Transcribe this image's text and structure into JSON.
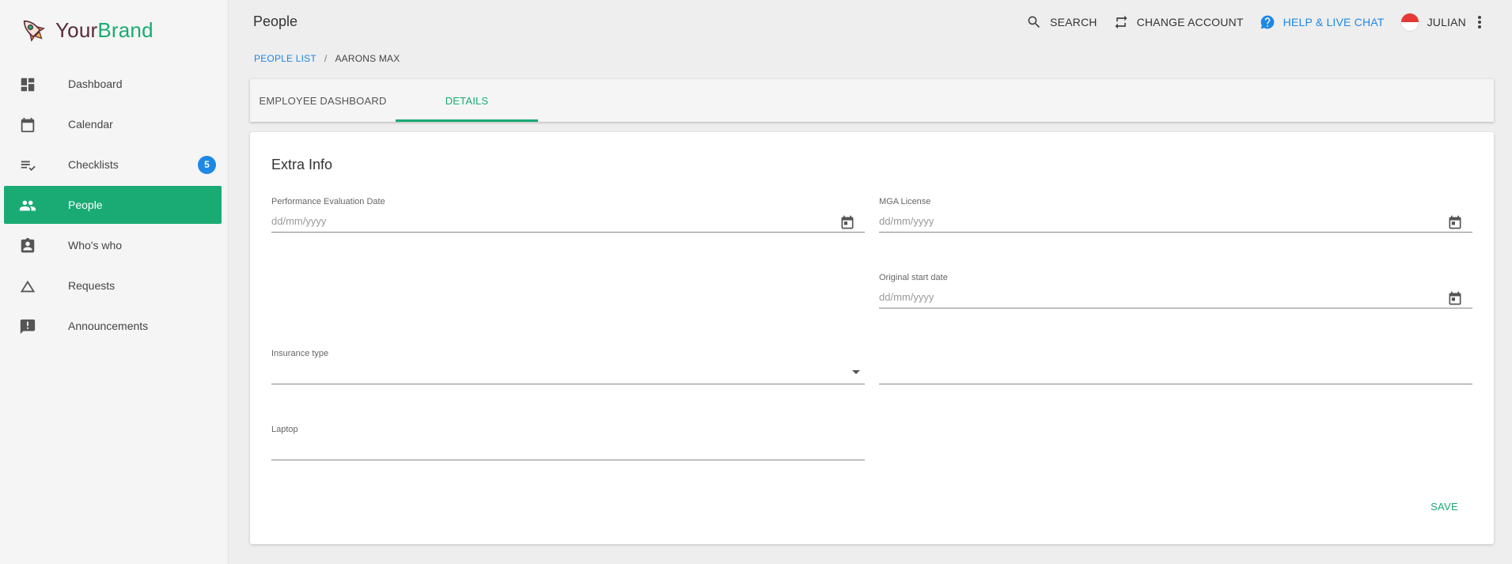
{
  "brand": {
    "part1": "Your",
    "part2": "Brand"
  },
  "sidebar": {
    "items": [
      {
        "label": "Dashboard",
        "icon": "dashboard-icon"
      },
      {
        "label": "Calendar",
        "icon": "calendar-icon"
      },
      {
        "label": "Checklists",
        "icon": "checklist-icon",
        "badge": "5"
      },
      {
        "label": "People",
        "icon": "people-icon",
        "active": true
      },
      {
        "label": "Who's who",
        "icon": "contact-card-icon"
      },
      {
        "label": "Requests",
        "icon": "triangle-icon"
      },
      {
        "label": "Announcements",
        "icon": "announcement-icon"
      }
    ]
  },
  "header": {
    "title": "People",
    "search_label": "SEARCH",
    "change_account_label": "CHANGE ACCOUNT",
    "help_label": "HELP & LIVE CHAT",
    "user_name": "JULIAN"
  },
  "breadcrumb": {
    "parent": "PEOPLE LIST",
    "separator": "/",
    "current": "AARONS MAX"
  },
  "tabs": [
    {
      "label": "EMPLOYEE DASHBOARD"
    },
    {
      "label": "DETAILS",
      "active": true
    }
  ],
  "form": {
    "title": "Extra Info",
    "performance_evaluation_date": {
      "label": "Performance Evaluation Date",
      "placeholder": "dd/mm/yyyy",
      "value": ""
    },
    "mga_license": {
      "label": "MGA License",
      "placeholder": "dd/mm/yyyy",
      "value": ""
    },
    "original_start_date": {
      "label": "Original start date",
      "placeholder": "dd/mm/yyyy",
      "value": ""
    },
    "insurance_type": {
      "label": "Insurance type",
      "value": ""
    },
    "unlabeled_field": {
      "label": "",
      "value": ""
    },
    "laptop": {
      "label": "Laptop",
      "value": ""
    },
    "save_label": "SAVE"
  },
  "colors": {
    "accent": "#1aab74",
    "link": "#1e88e5",
    "badge": "#1e88e5"
  }
}
